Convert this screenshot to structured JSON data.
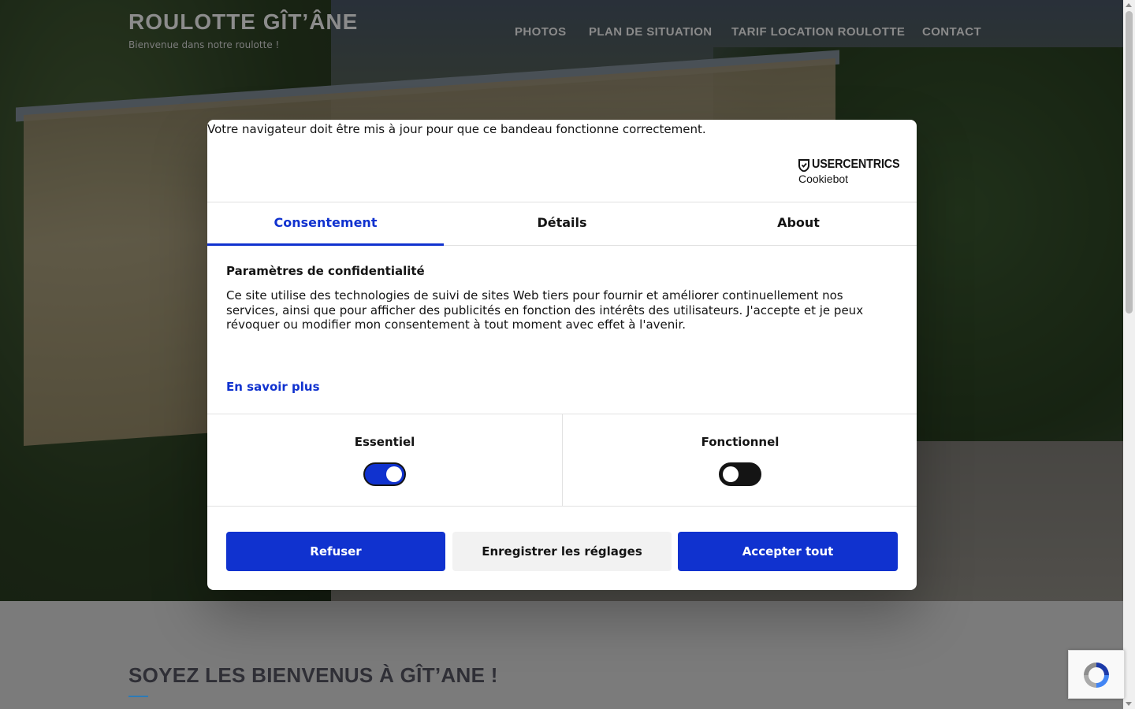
{
  "site": {
    "title": "ROULOTTE GÎT’ÂNE",
    "tagline": "Bienvenue dans notre roulotte !"
  },
  "nav": {
    "items": [
      {
        "label": "PHOTOS"
      },
      {
        "label": "PLAN DE SITUATION"
      },
      {
        "label": "TARIF LOCATION ROULOTTE"
      },
      {
        "label": "CONTACT"
      }
    ]
  },
  "welcome": {
    "heading": "SOYEZ LES BIENVENUS À GÎT’ANE !"
  },
  "cookie_dialog": {
    "browser_warning": "Votre navigateur doit être mis à jour pour que ce bandeau fonctionne correctement.",
    "brand": {
      "name": "USERCENTRICS",
      "product": "Cookiebot"
    },
    "tabs": [
      {
        "label": "Consentement",
        "active": true
      },
      {
        "label": "Détails",
        "active": false
      },
      {
        "label": "About",
        "active": false
      }
    ],
    "heading": "Paramètres de confidentialité",
    "body": "Ce site utilise des technologies de suivi de sites Web tiers pour fournir et améliorer continuellement nos services, ainsi que pour afficher des publicités en fonction des intérêts des utilisateurs. J'accepte et je peux révoquer ou modifier mon consentement à tout moment avec effet à l'avenir.",
    "learn_more": "En savoir plus",
    "toggles": [
      {
        "label": "Essentiel",
        "checked": true
      },
      {
        "label": "Fonctionnel",
        "checked": false
      }
    ],
    "buttons": {
      "deny": "Refuser",
      "save": "Enregistrer les réglages",
      "accept": "Accepter tout"
    }
  },
  "colors": {
    "accent": "#1032cf",
    "text": "#141414",
    "overlay": "rgba(0,0,0,0.48)"
  },
  "icons": {
    "brand": "usercentrics-shield-icon",
    "recaptcha": "recaptcha-icon"
  }
}
